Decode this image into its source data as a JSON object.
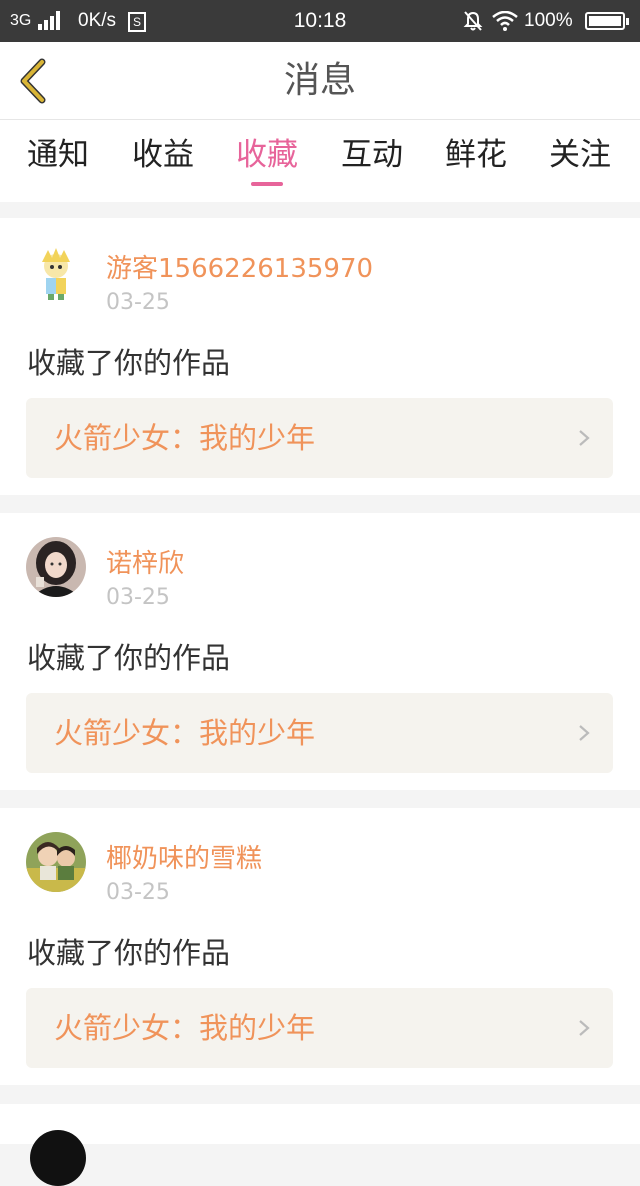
{
  "status_bar": {
    "network": "3G",
    "speed": "0K/s",
    "s_badge": "S",
    "time": "10:18",
    "battery": "100%"
  },
  "header": {
    "title": "消息",
    "back_icon": "chevron-left-icon",
    "accent": "#d9b536"
  },
  "tabs": [
    {
      "label": "通知",
      "active": false
    },
    {
      "label": "收益",
      "active": false
    },
    {
      "label": "收藏",
      "active": true
    },
    {
      "label": "互动",
      "active": false
    },
    {
      "label": "鲜花",
      "active": false
    },
    {
      "label": "关注",
      "active": false
    }
  ],
  "colors": {
    "active_tab": "#e7649a",
    "username": "#f0935a",
    "work_title": "#f0935a",
    "work_box_bg": "#f5f3ee"
  },
  "messages": [
    {
      "username": "游客1566226135970",
      "date": "03-25",
      "action": "收藏了你的作品",
      "work_title": "火箭少女：我的少年",
      "avatar": "cartoon-avatar"
    },
    {
      "username": "诺梓欣",
      "date": "03-25",
      "action": "收藏了你的作品",
      "work_title": "火箭少女：我的少年",
      "avatar": "photo-avatar"
    },
    {
      "username": "椰奶味的雪糕",
      "date": "03-25",
      "action": "收藏了你的作品",
      "work_title": "火箭少女：我的少年",
      "avatar": "photo-avatar"
    }
  ]
}
